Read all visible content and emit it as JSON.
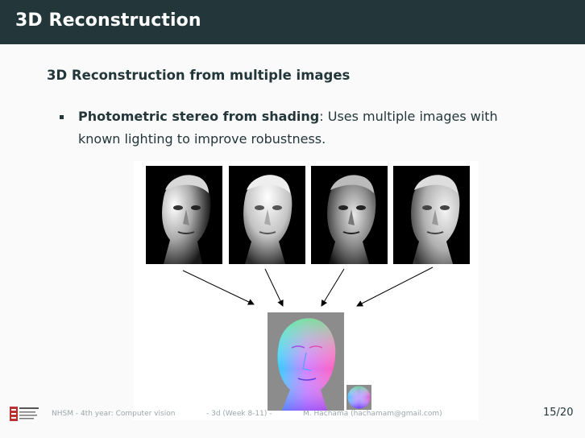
{
  "slide": {
    "title": "3D Reconstruction",
    "subtitle": "3D Reconstruction from multiple images",
    "bullets": [
      {
        "term": "Photometric stereo from shading",
        "text": ": Uses multiple images with known lighting to improve robustness."
      }
    ]
  },
  "figure": {
    "input_images": 4,
    "output": "surface normal map",
    "reference": "normal sphere"
  },
  "footer": {
    "course": "NHSM - 4th year: Computer vision",
    "section": "- 3d (Week 8-11) -",
    "author": "M. Hachama (hachamam@gmail.com)",
    "page": "15/20"
  },
  "colors": {
    "primary": "#23373b",
    "background": "#fafafa",
    "footer_text": "#9aa7aa"
  }
}
